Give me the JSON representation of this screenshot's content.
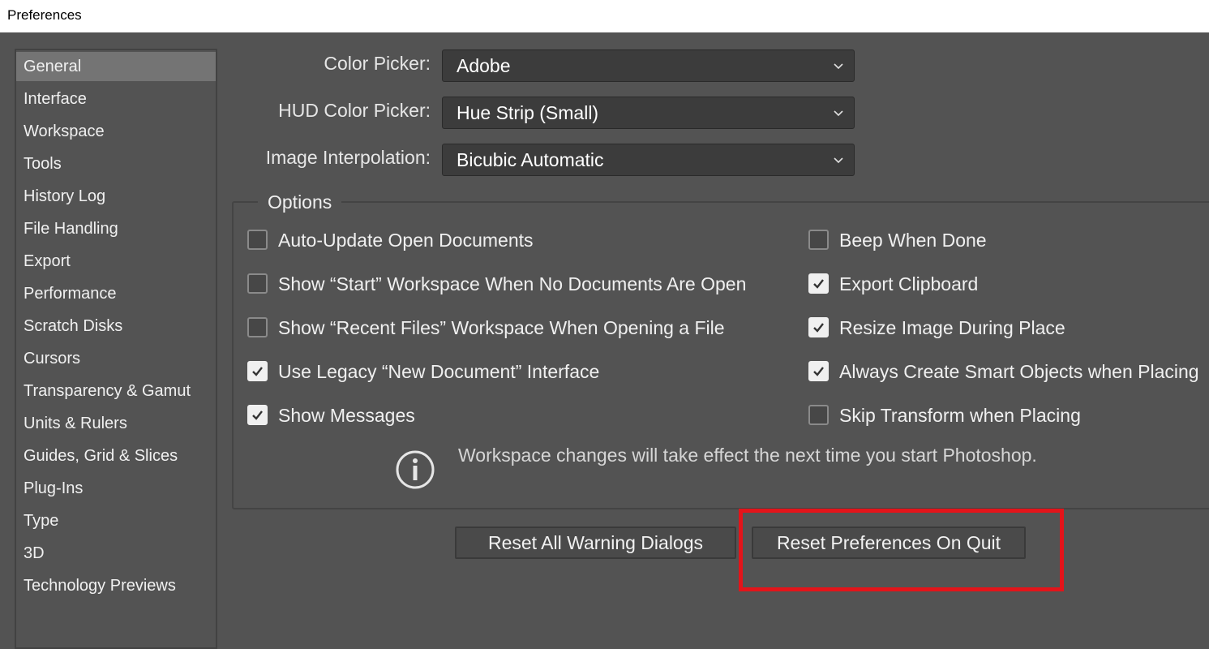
{
  "window": {
    "title": "Preferences"
  },
  "sidebar": {
    "items": [
      {
        "label": "General",
        "selected": true
      },
      {
        "label": "Interface"
      },
      {
        "label": "Workspace"
      },
      {
        "label": "Tools"
      },
      {
        "label": "History Log"
      },
      {
        "label": "File Handling"
      },
      {
        "label": "Export"
      },
      {
        "label": "Performance"
      },
      {
        "label": "Scratch Disks"
      },
      {
        "label": "Cursors"
      },
      {
        "label": "Transparency & Gamut"
      },
      {
        "label": "Units & Rulers"
      },
      {
        "label": "Guides, Grid & Slices"
      },
      {
        "label": "Plug-Ins"
      },
      {
        "label": "Type"
      },
      {
        "label": "3D"
      },
      {
        "label": "Technology Previews"
      }
    ]
  },
  "fields": {
    "color_picker": {
      "label": "Color Picker:",
      "value": "Adobe"
    },
    "hud_color_picker": {
      "label": "HUD Color Picker:",
      "value": "Hue Strip (Small)"
    },
    "image_interpolation": {
      "label": "Image Interpolation:",
      "value": "Bicubic Automatic"
    }
  },
  "options": {
    "title": "Options",
    "left": [
      {
        "label": "Auto-Update Open Documents",
        "checked": false
      },
      {
        "label": "Show “Start” Workspace When No Documents Are Open",
        "checked": false
      },
      {
        "label": "Show “Recent Files” Workspace When Opening a File",
        "checked": false
      },
      {
        "label": "Use Legacy “New Document” Interface",
        "checked": true
      },
      {
        "label": "Show Messages",
        "checked": true
      }
    ],
    "right": [
      {
        "label": "Beep When Done",
        "checked": false
      },
      {
        "label": "Export Clipboard",
        "checked": true
      },
      {
        "label": "Resize Image During Place",
        "checked": true
      },
      {
        "label": "Always Create Smart Objects when Placing",
        "checked": true
      },
      {
        "label": "Skip Transform when Placing",
        "checked": false
      }
    ],
    "info": "Workspace changes will take effect the next time you start Photoshop."
  },
  "buttons": {
    "reset_warnings": "Reset All Warning Dialogs",
    "reset_prefs": "Reset Preferences On Quit"
  },
  "colors": {
    "background": "#535353",
    "selected_item": "#747474",
    "highlight_box": "#e3141a"
  }
}
